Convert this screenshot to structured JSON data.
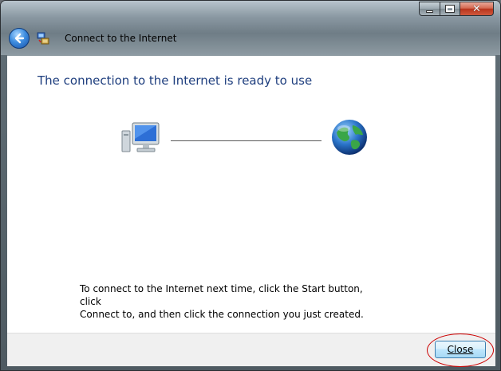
{
  "window": {
    "title": "Connect to the Internet",
    "icons": {
      "back": "back-arrow-icon",
      "wizard": "network-wizard-icon",
      "minimize": "minimize-icon",
      "maximize": "maximize-icon",
      "close": "close-icon"
    },
    "close_glyph": "✕"
  },
  "content": {
    "heading": "The connection to the Internet is ready to use",
    "diagram": {
      "left_icon": "computer-icon",
      "right_icon": "globe-icon"
    },
    "instructions_line1": "To connect to the Internet next time, click the Start button, click",
    "instructions_line2": "Connect to, and then click the connection you just created."
  },
  "footer": {
    "close_label": "Close"
  },
  "colors": {
    "heading": "#1e3e7e",
    "highlight": "#cc0000",
    "button_border": "#3c7fb1"
  }
}
